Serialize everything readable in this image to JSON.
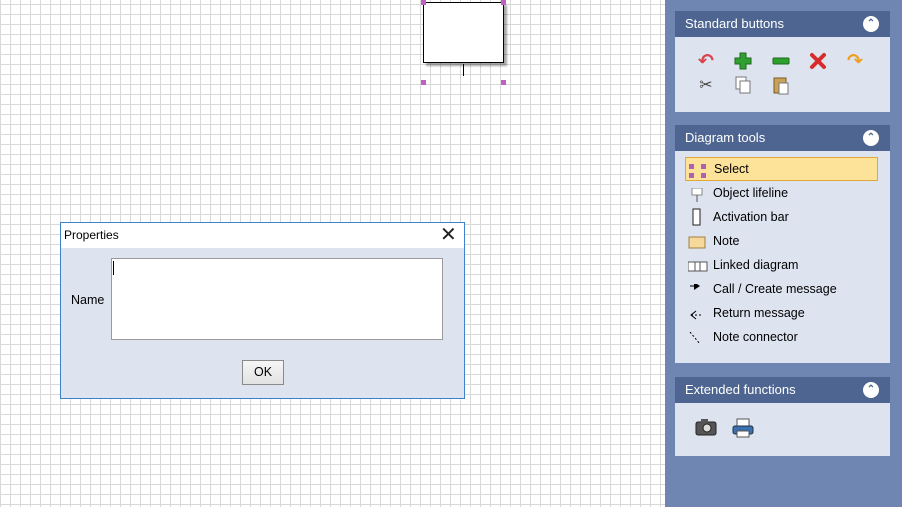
{
  "panel": {
    "standard": {
      "title": "Standard buttons",
      "icons": [
        "undo-icon",
        "add-icon",
        "remove-icon",
        "delete-icon",
        "redo-icon",
        "cut-icon",
        "copy-icon",
        "paste-icon"
      ]
    },
    "diagram_tools": {
      "title": "Diagram tools",
      "items": [
        {
          "label": "Select",
          "icon": "select-icon"
        },
        {
          "label": "Object lifeline",
          "icon": "object-lifeline-icon"
        },
        {
          "label": "Activation bar",
          "icon": "activation-bar-icon"
        },
        {
          "label": "Note",
          "icon": "note-icon"
        },
        {
          "label": "Linked diagram",
          "icon": "linked-diagram-icon"
        },
        {
          "label": "Call / Create message",
          "icon": "call-message-icon"
        },
        {
          "label": "Return message",
          "icon": "return-message-icon"
        },
        {
          "label": "Note connector",
          "icon": "note-connector-icon"
        }
      ]
    },
    "extended": {
      "title": "Extended functions",
      "icons": [
        "camera-icon",
        "printer-icon"
      ]
    }
  },
  "dialog": {
    "title": "Properties",
    "name_label": "Name",
    "name_value": "",
    "ok_label": "OK"
  },
  "colors": {
    "panel_bg": "#6f86b2",
    "header_bg": "#4d6590",
    "group_bg": "#dde3ef",
    "selected_bg": "#fde39a"
  }
}
